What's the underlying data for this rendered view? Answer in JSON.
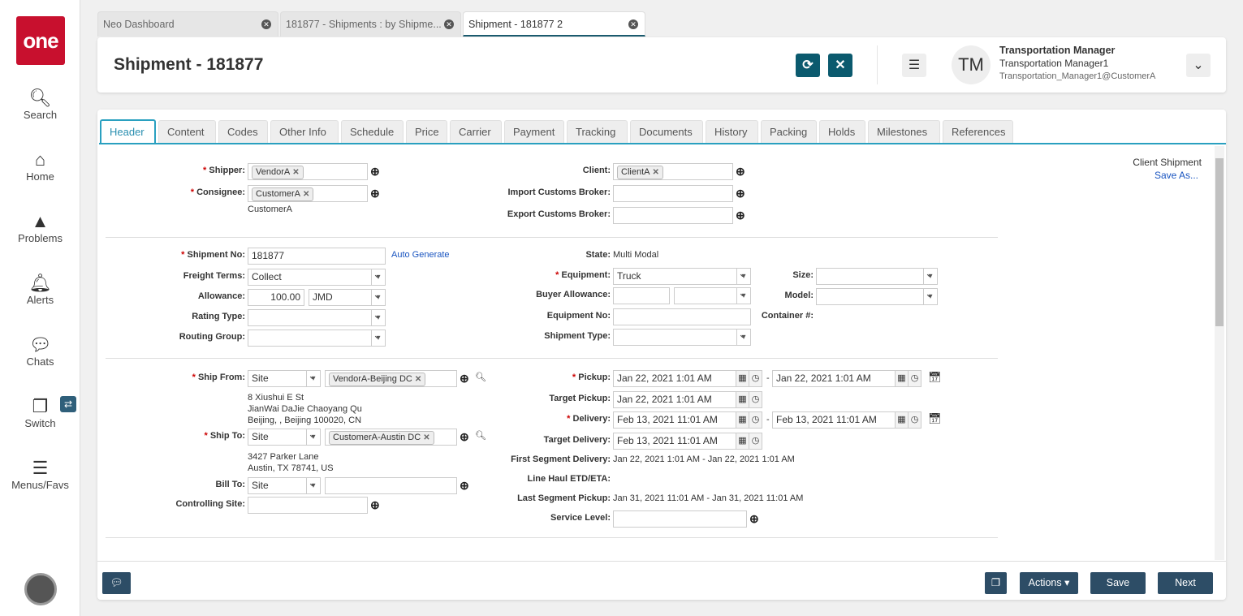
{
  "sidebar": {
    "logo": "one",
    "items": [
      {
        "label": "Search",
        "icon": "search-icon"
      },
      {
        "label": "Home",
        "icon": "home-icon"
      },
      {
        "label": "Problems",
        "icon": "warning-icon"
      },
      {
        "label": "Alerts",
        "icon": "bell-icon"
      },
      {
        "label": "Chats",
        "icon": "chat-icon"
      },
      {
        "label": "Switch",
        "icon": "switch-icon"
      },
      {
        "label": "Menus/Favs",
        "icon": "menu-icon"
      }
    ]
  },
  "tabs": [
    {
      "label": "Neo Dashboard"
    },
    {
      "label": "181877 - Shipments : by Shipme..."
    },
    {
      "label": "Shipment - 181877 2",
      "active": true
    }
  ],
  "header": {
    "title": "Shipment - 181877",
    "user": {
      "initials": "TM",
      "role": "Transportation Manager",
      "name": "Transportation Manager1",
      "login": "Transportation_Manager1@CustomerA"
    }
  },
  "form_tabs": [
    "Header",
    "Content",
    "Codes",
    "Other Info",
    "Schedule",
    "Price",
    "Carrier",
    "Payment",
    "Tracking",
    "Documents",
    "History",
    "Packing",
    "Holds",
    "Milestones",
    "References"
  ],
  "side": {
    "client_shipment": "Client Shipment",
    "save_as": "Save As..."
  },
  "fields": {
    "shipper": {
      "label": "Shipper:",
      "value": "VendorA"
    },
    "consignee": {
      "label": "Consignee:",
      "value": "CustomerA",
      "note": "CustomerA"
    },
    "client": {
      "label": "Client:",
      "value": "ClientA"
    },
    "import_broker": {
      "label": "Import Customs Broker:",
      "value": ""
    },
    "export_broker": {
      "label": "Export Customs Broker:",
      "value": ""
    },
    "shipment_no": {
      "label": "Shipment No:",
      "value": "181877",
      "link": "Auto Generate"
    },
    "state": {
      "label": "State:",
      "value": "Multi Modal"
    },
    "freight_terms": {
      "label": "Freight Terms:",
      "value": "Collect"
    },
    "equipment": {
      "label": "Equipment:",
      "value": "Truck"
    },
    "size": {
      "label": "Size:",
      "value": ""
    },
    "allowance": {
      "label": "Allowance:",
      "value": "100.00",
      "currency": "JMD"
    },
    "buyer_allowance": {
      "label": "Buyer Allowance:",
      "value": "",
      "currency": ""
    },
    "model": {
      "label": "Model:",
      "value": ""
    },
    "rating_type": {
      "label": "Rating Type:",
      "value": ""
    },
    "equipment_no": {
      "label": "Equipment No:",
      "value": ""
    },
    "container": {
      "label": "Container #:",
      "value": ""
    },
    "routing_group": {
      "label": "Routing Group:",
      "value": ""
    },
    "shipment_type": {
      "label": "Shipment Type:",
      "value": ""
    },
    "ship_from": {
      "label": "Ship From:",
      "type": "Site",
      "value": "VendorA-Beijing DC",
      "address": [
        "8 Xiushui E St",
        "JianWai DaJie Chaoyang Qu",
        "Beijing, , Beijing 100020, CN"
      ]
    },
    "ship_to": {
      "label": "Ship To:",
      "type": "Site",
      "value": "CustomerA-Austin DC",
      "address": [
        "3427 Parker Lane",
        "Austin, TX 78741, US"
      ]
    },
    "bill_to": {
      "label": "Bill To:",
      "type": "Site",
      "value": ""
    },
    "controlling_site": {
      "label": "Controlling Site:",
      "value": ""
    },
    "pickup": {
      "label": "Pickup:",
      "from": "Jan 22, 2021 1:01 AM",
      "to": "Jan 22, 2021 1:01 AM"
    },
    "target_pickup": {
      "label": "Target Pickup:",
      "value": "Jan 22, 2021 1:01 AM"
    },
    "delivery": {
      "label": "Delivery:",
      "from": "Feb 13, 2021 11:01 AM",
      "to": "Feb 13, 2021 11:01 AM"
    },
    "target_delivery": {
      "label": "Target Delivery:",
      "value": "Feb 13, 2021 11:01 AM"
    },
    "first_segment": {
      "label": "First Segment Delivery:",
      "value": "Jan 22, 2021 1:01 AM - Jan 22, 2021 1:01 AM"
    },
    "line_haul": {
      "label": "Line Haul ETD/ETA:",
      "value": ""
    },
    "last_segment": {
      "label": "Last Segment Pickup:",
      "value": "Jan 31, 2021 11:01 AM - Jan 31, 2021 11:01 AM"
    },
    "service_level": {
      "label": "Service Level:",
      "value": ""
    }
  },
  "footer": {
    "actions": "Actions",
    "save": "Save",
    "next": "Next"
  },
  "colors": {
    "accent": "#0b5a6e",
    "tab_active": "#2aa0c0",
    "footer_button": "#2d4d66",
    "logo": "#c8102e"
  }
}
